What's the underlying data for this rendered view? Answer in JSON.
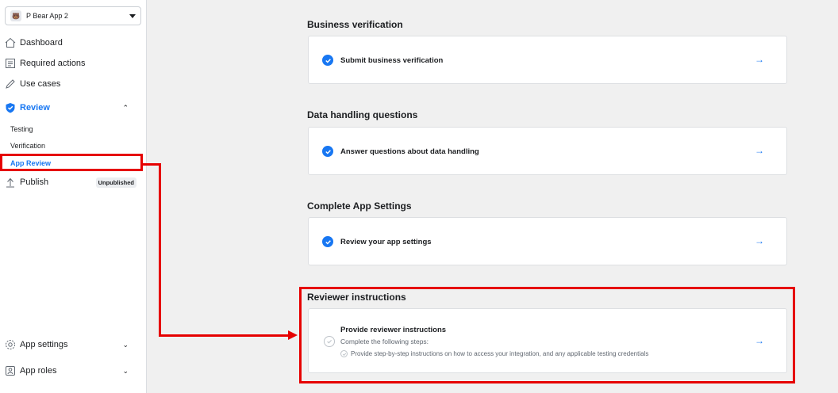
{
  "sidebar": {
    "app_name": "P Bear App 2",
    "items": {
      "dashboard": "Dashboard",
      "required_actions": "Required actions",
      "use_cases": "Use cases",
      "review": "Review",
      "testing": "Testing",
      "verification": "Verification",
      "app_review": "App Review",
      "publish": "Publish",
      "publish_badge": "Unpublished",
      "app_settings": "App settings",
      "app_roles": "App roles"
    }
  },
  "main": {
    "sections": [
      {
        "title": "Business verification",
        "item": "Submit business verification",
        "status": "done"
      },
      {
        "title": "Data handling questions",
        "item": "Answer questions about data handling",
        "status": "done"
      },
      {
        "title": "Complete App Settings",
        "item": "Review your app settings",
        "status": "done"
      },
      {
        "title": "Reviewer instructions",
        "item": "Provide reviewer instructions",
        "subtitle": "Complete the following steps:",
        "step": "Provide step-by-step instructions on how to access your integration, and any applicable testing credentials",
        "status": "pending"
      }
    ],
    "arrow_glyph": "→"
  },
  "colors": {
    "accent": "#1877f2",
    "highlight": "#e60000"
  },
  "icons": [
    "chevron-down-icon",
    "home-icon",
    "checklist-icon",
    "pencil-icon",
    "shield-check-icon",
    "chevron-up-icon",
    "publish-icon",
    "gear-icon",
    "roles-icon",
    "check-icon",
    "arrow-right-icon"
  ]
}
